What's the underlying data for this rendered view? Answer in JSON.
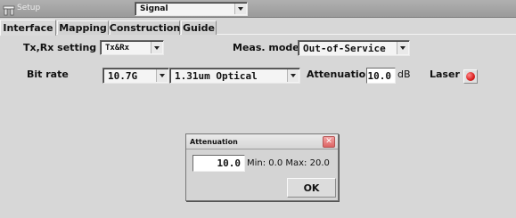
{
  "window": {
    "title": "Setup",
    "view_selector": "Signal"
  },
  "tabs": [
    {
      "label": "Interface",
      "active": true
    },
    {
      "label": "Mapping",
      "active": false
    },
    {
      "label": "Construction",
      "active": false
    },
    {
      "label": "Guide",
      "active": false
    }
  ],
  "settings": {
    "txrx_label": "Tx,Rx setting",
    "txrx_value": "Tx&Rx",
    "meas_mode_label": "Meas. mode",
    "meas_mode_value": "Out-of-Service",
    "bitrate_label": "Bit rate",
    "bitrate_value": "10.7G",
    "optical_value": "1.31um Optical",
    "attenuation_label": "Attenuation",
    "attenuation_value": "10.0",
    "attenuation_unit": "dB",
    "laser_label": "Laser",
    "laser_state_color": "#d91e1e"
  },
  "dialog": {
    "title": "Attenuation",
    "value": "10.0",
    "range_text": "Min: 0.0 Max: 20.0",
    "ok_label": "OK"
  },
  "icons": {
    "app": "tool-icon",
    "close": "close-icon",
    "dropdown": "chevron-down-icon",
    "laser": "led-indicator-icon"
  }
}
